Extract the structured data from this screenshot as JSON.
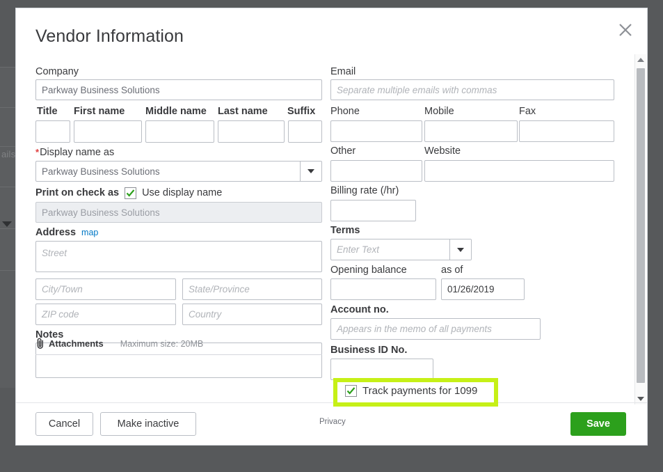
{
  "backdrop": {
    "partial_text": "ails"
  },
  "modal": {
    "title": "Vendor Information",
    "close_icon": "close-icon"
  },
  "left": {
    "company": {
      "label": "Company",
      "value": "Parkway Business Solutions"
    },
    "name_row": [
      {
        "label": "Title",
        "value": ""
      },
      {
        "label": "First name",
        "value": ""
      },
      {
        "label": "Middle name",
        "value": ""
      },
      {
        "label": "Last name",
        "value": ""
      },
      {
        "label": "Suffix",
        "value": ""
      }
    ],
    "display_name": {
      "required_marker": "*",
      "label": "Display name as",
      "value": "Parkway Business Solutions",
      "caret_icon": "chevron-down-icon"
    },
    "print_on_check": {
      "label": "Print on check as",
      "checkbox_checked": true,
      "checkbox_label": "Use display name",
      "value": "Parkway Business Solutions"
    },
    "address": {
      "label": "Address",
      "map_link": "map",
      "street_placeholder": "Street",
      "city_placeholder": "City/Town",
      "state_placeholder": "State/Province",
      "zip_placeholder": "ZIP code",
      "country_placeholder": "Country",
      "street_value": "",
      "city_value": "",
      "state_value": "",
      "zip_value": "",
      "country_value": ""
    },
    "notes": {
      "label": "Notes",
      "value": ""
    },
    "attachments": {
      "icon": "paperclip-icon",
      "label": "Attachments",
      "max_size": "Maximum size: 20MB"
    }
  },
  "right": {
    "email": {
      "label": "Email",
      "placeholder": "Separate multiple emails with commas",
      "value": ""
    },
    "phone_row": [
      {
        "label": "Phone",
        "value": ""
      },
      {
        "label": "Mobile",
        "value": ""
      },
      {
        "label": "Fax",
        "value": ""
      }
    ],
    "other_row": [
      {
        "label": "Other",
        "value": ""
      },
      {
        "label": "Website",
        "value": ""
      }
    ],
    "billing_rate": {
      "label": "Billing rate (/hr)",
      "value": ""
    },
    "terms": {
      "label": "Terms",
      "placeholder": "Enter Text",
      "value": "",
      "caret_icon": "chevron-down-icon"
    },
    "opening_balance": {
      "label": "Opening balance",
      "value": ""
    },
    "as_of": {
      "label": "as of",
      "value": "01/26/2019"
    },
    "account_no": {
      "label": "Account no.",
      "placeholder": "Appears in the memo of all payments",
      "value": ""
    },
    "business_id": {
      "label": "Business ID No.",
      "value": ""
    },
    "track_1099": {
      "checked": true,
      "label": "Track payments for 1099"
    }
  },
  "footer": {
    "cancel": "Cancel",
    "make_inactive": "Make inactive",
    "privacy": "Privacy",
    "save": "Save"
  },
  "colors": {
    "highlight": "#c6f017",
    "save_green": "#2ca01c",
    "check_green": "#2ca01c",
    "link_blue": "#0077c5",
    "required_red": "#e03e3e",
    "overlay": "#57595b"
  },
  "scrollbar": {
    "up_icon": "chevron-up-icon",
    "down_icon": "chevron-down-icon"
  }
}
